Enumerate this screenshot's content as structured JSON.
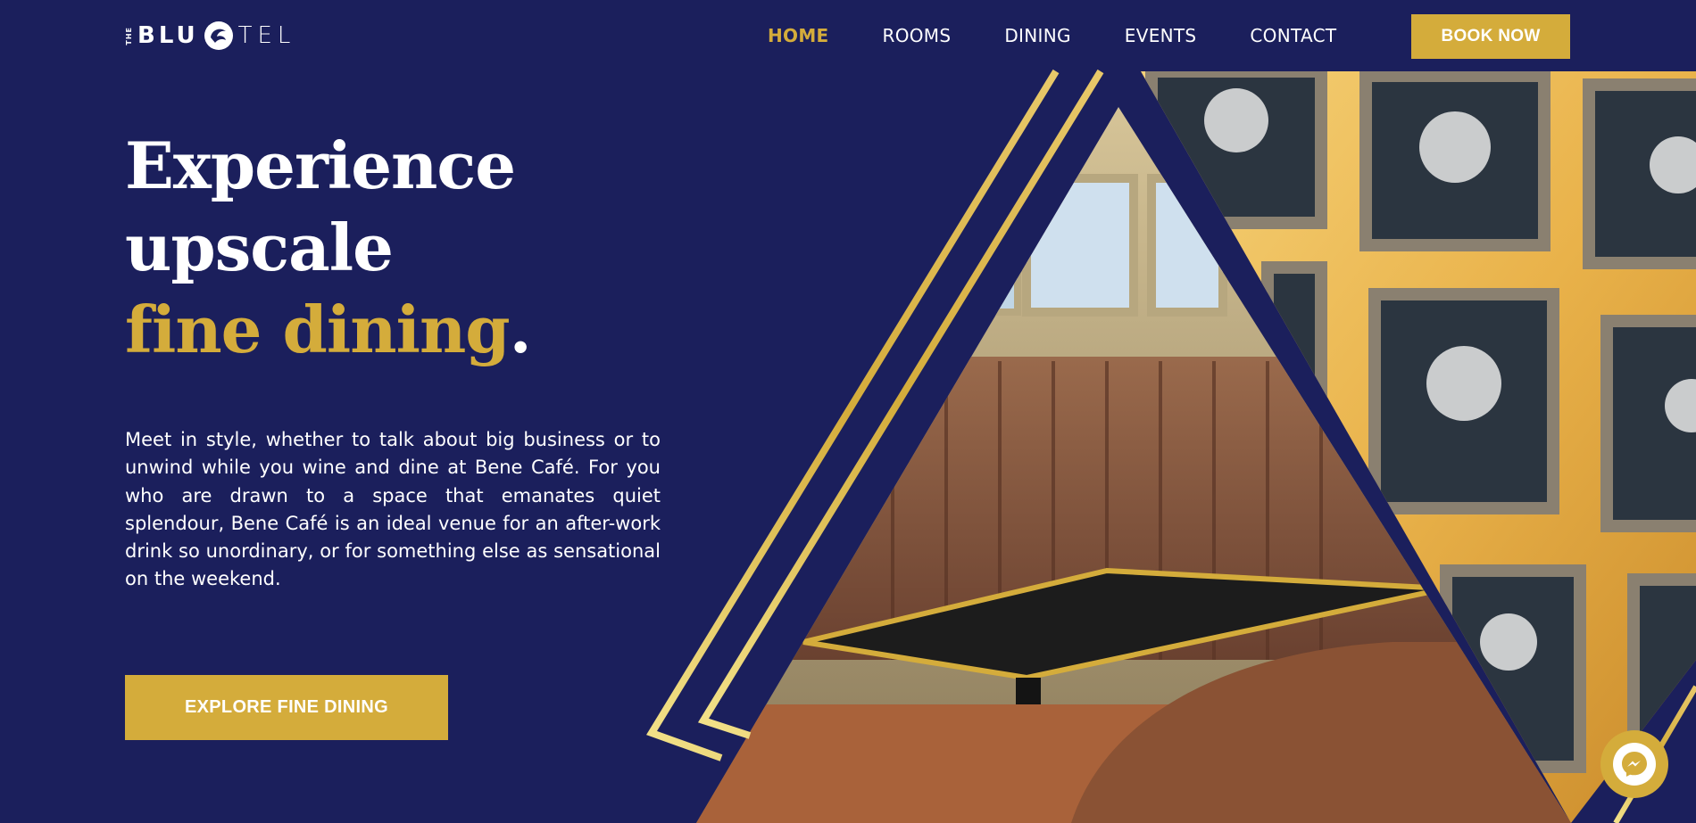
{
  "brand": {
    "logo_the": "THE",
    "logo_blu": "BLU",
    "logo_tel": "TEL"
  },
  "nav": {
    "items": [
      {
        "label": "HOME",
        "active": true
      },
      {
        "label": "ROOMS",
        "active": false
      },
      {
        "label": "DINING",
        "active": false
      },
      {
        "label": "EVENTS",
        "active": false
      },
      {
        "label": "CONTACT",
        "active": false
      }
    ],
    "book_label": "BOOK NOW"
  },
  "hero": {
    "line1": "Experience",
    "line2": "upscale",
    "line3_gold": "fine dining",
    "line3_dot": ".",
    "description": "Meet in style, whether to talk about big business or to unwind while you wine and dine at Bene Café. For you who are drawn to a space that emanates quiet splendour, Bene Café is an ideal venue for an after-work drink so unordinary, or for something else as sensational on the weekend.",
    "cta_label": "EXPLORE FINE DINING"
  },
  "icons": {
    "logo_mark": "dolphin-logo-icon",
    "chat": "messenger-icon"
  },
  "colors": {
    "background": "#1b1f5c",
    "accent": "#d4ac3b",
    "text": "#ffffff"
  }
}
